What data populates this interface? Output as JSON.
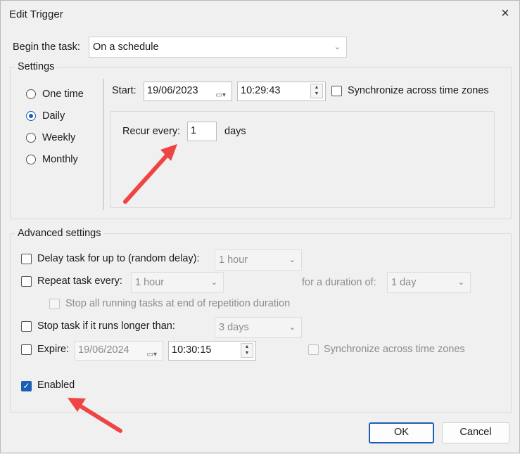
{
  "window": {
    "title": "Edit Trigger",
    "close_icon": "×"
  },
  "begin": {
    "label": "Begin the task:",
    "value": "On a schedule"
  },
  "settings": {
    "legend": "Settings",
    "radios": [
      {
        "label": "One time",
        "checked": false
      },
      {
        "label": "Daily",
        "checked": true
      },
      {
        "label": "Weekly",
        "checked": false
      },
      {
        "label": "Monthly",
        "checked": false
      }
    ],
    "start_label": "Start:",
    "start_date": "19/06/2023",
    "start_time": "10:29:43",
    "sync_label": "Synchronize across time zones",
    "recur_label": "Recur every:",
    "recur_value": "1",
    "recur_unit": "days"
  },
  "advanced": {
    "legend": "Advanced settings",
    "delay_label": "Delay task for up to (random delay):",
    "delay_value": "1 hour",
    "repeat_label": "Repeat task every:",
    "repeat_value": "1 hour",
    "duration_label": "for a duration of:",
    "duration_value": "1 day",
    "stop_running_label": "Stop all running tasks at end of repetition duration",
    "stop_longer_label": "Stop task if it runs longer than:",
    "stop_longer_value": "3 days",
    "expire_label": "Expire:",
    "expire_date": "19/06/2024",
    "expire_time": "10:30:15",
    "expire_sync_label": "Synchronize across time zones",
    "enabled_label": "Enabled",
    "enabled_check": "✓"
  },
  "buttons": {
    "ok": "OK",
    "cancel": "Cancel"
  },
  "annotations": {
    "arrow_color": "#ef4444"
  }
}
